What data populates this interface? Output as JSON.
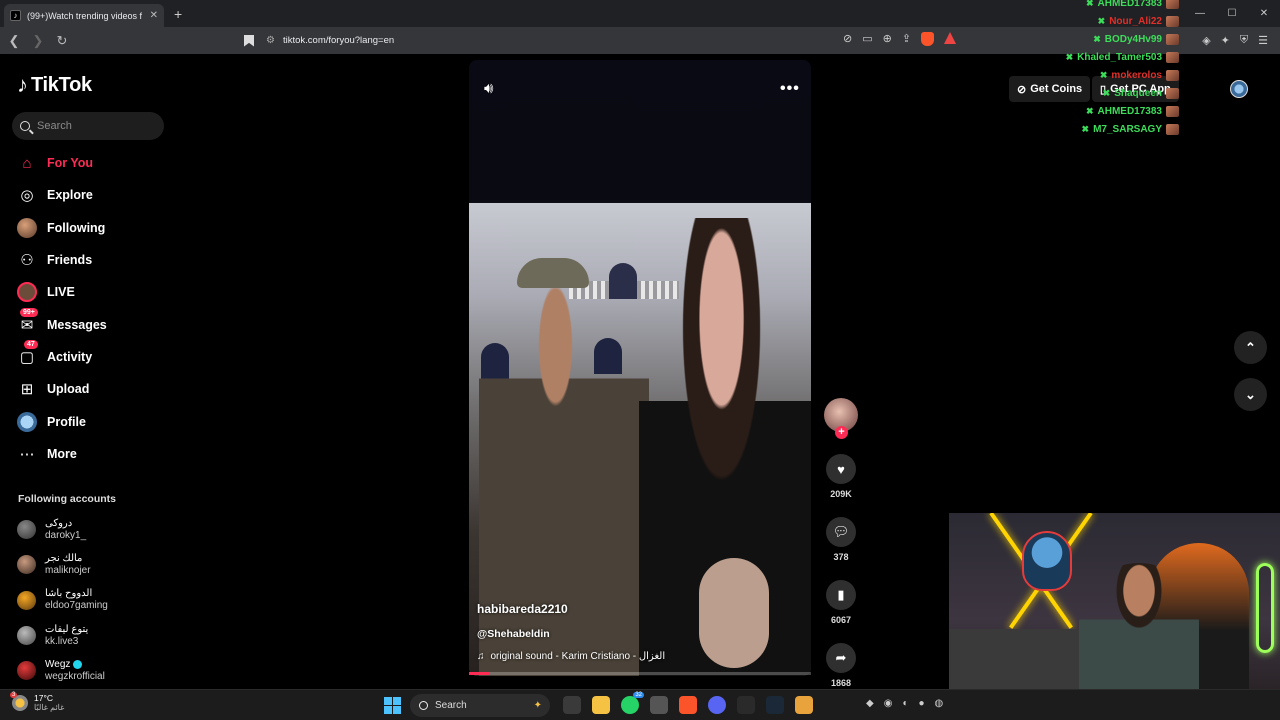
{
  "browser": {
    "tab_title": "(99+)Watch trending videos f",
    "tab_close": "✕",
    "new_tab": "+",
    "url": "tiktok.com/foryou?lang=en",
    "win_min": "—",
    "win_max": "☐",
    "win_close": "✕"
  },
  "tiktok": {
    "logo_text": "TikTok",
    "search_placeholder": "Search",
    "nav": [
      {
        "label": "For You",
        "icon": "home-icon"
      },
      {
        "label": "Explore",
        "icon": "compass-icon"
      },
      {
        "label": "Following",
        "icon": "following-avatar-icon"
      },
      {
        "label": "Friends",
        "icon": "friends-icon"
      },
      {
        "label": "LIVE",
        "icon": "live-icon"
      },
      {
        "label": "Messages",
        "icon": "messages-icon",
        "badge": "99+"
      },
      {
        "label": "Activity",
        "icon": "activity-icon",
        "badge": "47"
      },
      {
        "label": "Upload",
        "icon": "upload-icon"
      },
      {
        "label": "Profile",
        "icon": "profile-avatar-icon"
      },
      {
        "label": "More",
        "icon": "more-dots-icon"
      }
    ],
    "following_title": "Following accounts",
    "following_accounts": [
      {
        "name": "دروكى",
        "username": "daroky1_"
      },
      {
        "name": "مالك نجر",
        "username": "maliknojer"
      },
      {
        "name": "الدووح باشا",
        "username": "eldoo7gaming"
      },
      {
        "name": "يتوع ليفات",
        "username": "kk.live3"
      },
      {
        "name": "Wegz",
        "username": "wegzkrofficial",
        "verified": true
      }
    ],
    "header": {
      "get_coins": "Get Coins",
      "pc_app": "Get PC App"
    },
    "video": {
      "author": "habibareda2210",
      "mention": "@Shehabeldin",
      "music": "original sound - Karim Cristiano - الغزال",
      "progress": 0.06
    },
    "actions": {
      "likes": "209K",
      "comments": "378",
      "saves": "6067",
      "shares": "1868"
    }
  },
  "chat_overlay": [
    {
      "user": "AHMED17383",
      "color": "#3ddc5a"
    },
    {
      "user": "Nour_Ali22",
      "color": "#e0302a"
    },
    {
      "user": "BODy4Hv99",
      "color": "#3ddc5a"
    },
    {
      "user": "Khaled_Tamer503",
      "color": "#3ddc5a"
    },
    {
      "user": "mokerolos",
      "color": "#e0302a"
    },
    {
      "user": "Shaqueen",
      "color": "#3ddc5a"
    },
    {
      "user": "AHMED17383",
      "color": "#3ddc5a"
    },
    {
      "user": "M7_SARSAGY",
      "color": "#3ddc5a"
    }
  ],
  "taskbar": {
    "temp": "17°C",
    "condition": "غائم غالبًا",
    "weather_badge": "3",
    "search": "Search",
    "whatsapp_count": "32"
  },
  "colors": {
    "accent": "#fe2c55",
    "win_blue": "#4cc2ff"
  }
}
